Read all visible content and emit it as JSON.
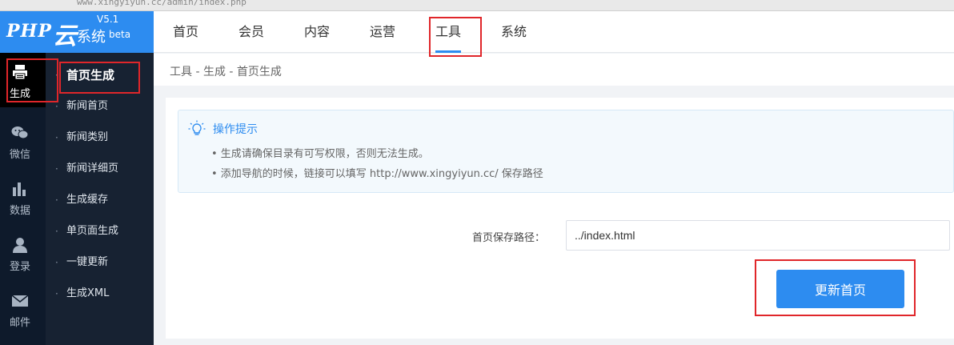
{
  "browser": {
    "url": "www.xingyiyun.cc/admin/index.php"
  },
  "logo": {
    "brand": "PHP",
    "yun": "云",
    "system": "系统",
    "version": "V5.1",
    "beta": "beta"
  },
  "topnav": {
    "items": [
      {
        "label": "首页"
      },
      {
        "label": "会员"
      },
      {
        "label": "内容"
      },
      {
        "label": "运营"
      },
      {
        "label": "工具"
      },
      {
        "label": "系统"
      }
    ],
    "active": "工具"
  },
  "iconbar": {
    "items": [
      {
        "label": "生成",
        "icon": "printer-icon"
      },
      {
        "label": "微信",
        "icon": "wechat-icon"
      },
      {
        "label": "数据",
        "icon": "bar-chart-icon"
      },
      {
        "label": "登录",
        "icon": "user-icon"
      },
      {
        "label": "邮件",
        "icon": "envelope-icon"
      }
    ]
  },
  "submenu": {
    "items": [
      {
        "label": "首页生成"
      },
      {
        "label": "新闻首页"
      },
      {
        "label": "新闻类别"
      },
      {
        "label": "新闻详细页"
      },
      {
        "label": "生成缓存"
      },
      {
        "label": "单页面生成"
      },
      {
        "label": "一键更新"
      },
      {
        "label": "生成XML"
      }
    ]
  },
  "breadcrumb": "工具 - 生成 - 首页生成",
  "tip": {
    "title": "操作提示",
    "lines": [
      "• 生成请确保目录有可写权限，否则无法生成。",
      "• 添加导航的时候，链接可以填写 http://www.xingyiyun.cc/ 保存路径"
    ]
  },
  "form": {
    "path_label": "首页保存路径：",
    "path_value": "../index.html",
    "submit_label": "更新首页"
  },
  "colors": {
    "accent": "#2d8cf0",
    "sidebar": "#0e1a2b",
    "submenu": "#172232",
    "annotation": "#e0262a"
  }
}
